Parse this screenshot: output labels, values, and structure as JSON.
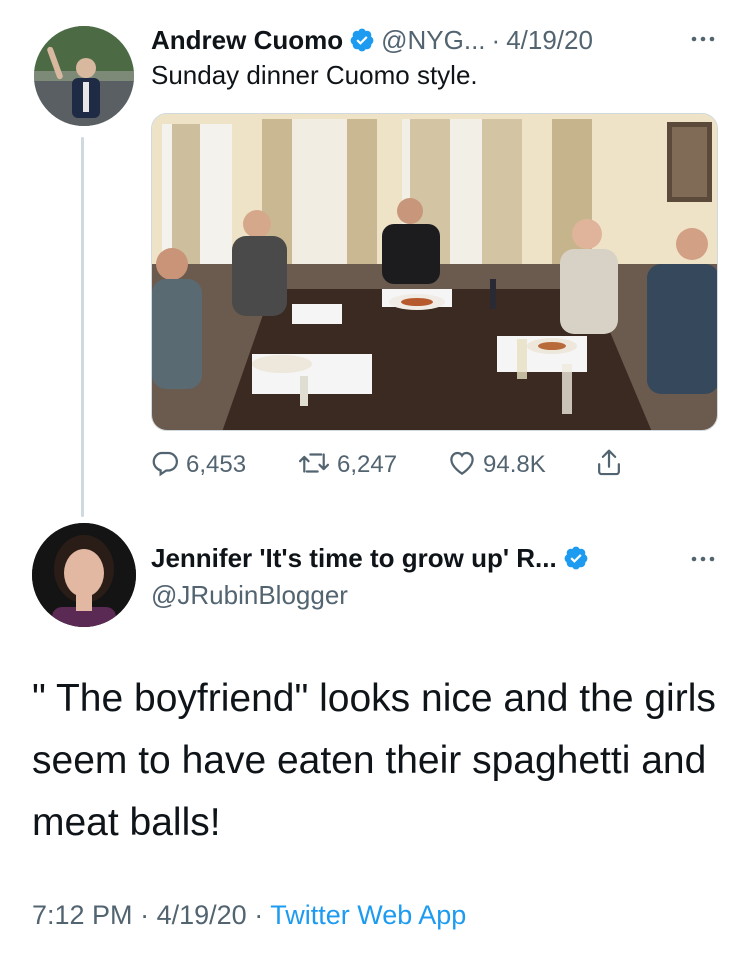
{
  "tweet1": {
    "author_name": "Andrew Cuomo",
    "handle": "@NYG...",
    "separator": "·",
    "date": "4/19/20",
    "text": "Sunday dinner Cuomo style.",
    "reply_count": "6,453",
    "retweet_count": "6,247",
    "like_count": "94.8K",
    "verified": true
  },
  "tweet2": {
    "author_name": "Jennifer 'It's time to grow up' R...",
    "handle": "@JRubinBlogger",
    "text": "\" The boyfriend\" looks nice and the girls seem to have eaten their spaghetti and meat balls!",
    "time": "7:12 PM",
    "separator": "·",
    "date": "4/19/20",
    "app": "Twitter Web App",
    "verified": true
  },
  "colors": {
    "verified_blue": "#1d9bf0",
    "secondary_text": "#536471",
    "primary_text": "#0f1419",
    "thread_line": "#cfd9de"
  },
  "icons": {
    "reply": "reply-icon",
    "retweet": "retweet-icon",
    "like": "heart-icon",
    "share": "share-icon",
    "more": "more-icon",
    "verified": "verified-badge-icon"
  }
}
